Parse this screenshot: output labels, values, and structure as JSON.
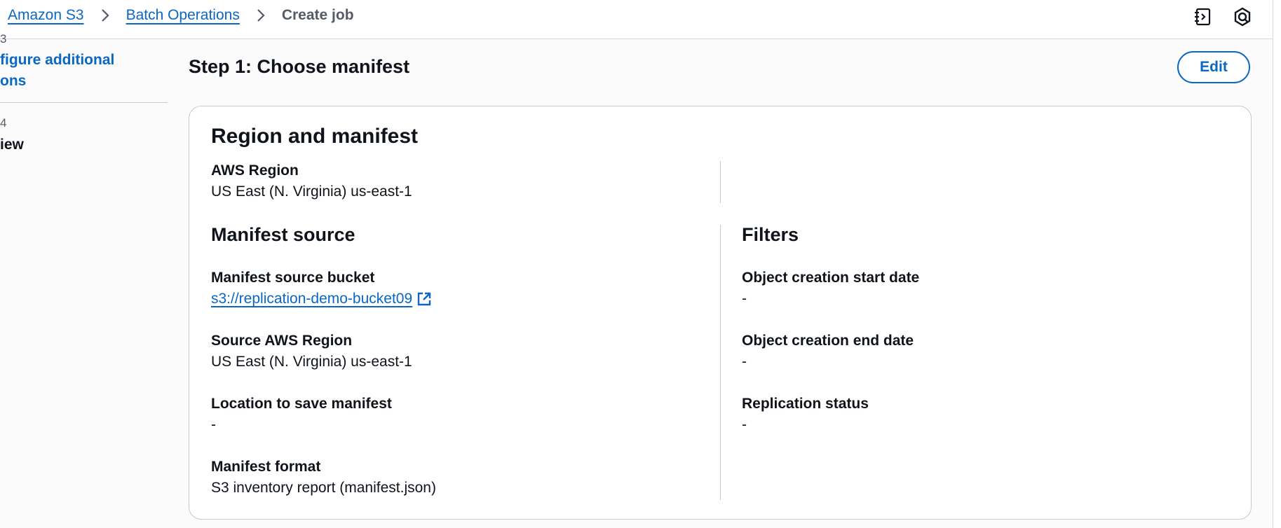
{
  "breadcrumb": {
    "items": [
      "Amazon S3",
      "Batch Operations"
    ],
    "current": "Create job"
  },
  "top_icons": [
    "notes-icon",
    "cloudshell-icon"
  ],
  "sidebar": {
    "step3_num": "3",
    "step3_label_line1": "figure additional",
    "step3_label_line2": "ons",
    "step4_num": "4",
    "step4_label": "iew"
  },
  "main": {
    "step_title": "Step 1: Choose manifest",
    "edit_label": "Edit",
    "card": {
      "title": "Region and manifest",
      "aws_region": {
        "label": "AWS Region",
        "value": "US East (N. Virginia) us-east-1"
      },
      "manifest_source": {
        "title": "Manifest source",
        "bucket": {
          "label": "Manifest source bucket",
          "value": "s3://replication-demo-bucket09"
        },
        "source_region": {
          "label": "Source AWS Region",
          "value": "US East (N. Virginia) us-east-1"
        },
        "save_location": {
          "label": "Location to save manifest",
          "value": "-"
        },
        "format": {
          "label": "Manifest format",
          "value": "S3 inventory report (manifest.json)"
        }
      },
      "filters": {
        "title": "Filters",
        "start_date": {
          "label": "Object creation start date",
          "value": "-"
        },
        "end_date": {
          "label": "Object creation end date",
          "value": "-"
        },
        "replication_status": {
          "label": "Replication status",
          "value": "-"
        }
      }
    }
  },
  "colors": {
    "link": "#0a67c2",
    "text": "#0f141a",
    "muted": "#545b64",
    "border": "#c6cbd0"
  }
}
